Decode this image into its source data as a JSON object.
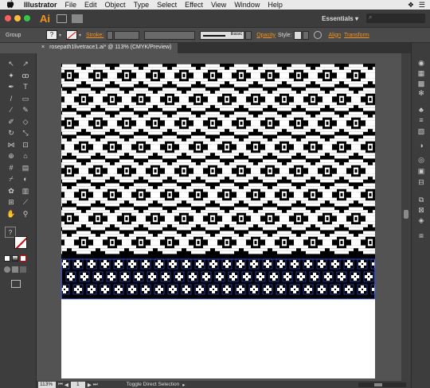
{
  "menubar": {
    "apple_icon": "apple-logo-icon",
    "app_name": "Illustrator",
    "items": [
      "File",
      "Edit",
      "Object",
      "Type",
      "Select",
      "Effect",
      "View",
      "Window",
      "Help"
    ],
    "status_glyph_1": "❖",
    "status_glyph_2": "☰"
  },
  "appbar": {
    "logo": "Ai",
    "workspace": "Essentials",
    "workspace_arrow": "▾",
    "search_glyph": "⌕"
  },
  "control": {
    "selection_type": "Group",
    "fill_q": "?",
    "stroke_label": "Stroke:",
    "brush_label": "Basic",
    "opacity_label": "Opacity",
    "style_label": "Style:",
    "align_label": "Align",
    "transform_label": "Transform"
  },
  "document": {
    "tab_title": "rosepath1livetrace1.ai* @ 113% (CMYK/Preview)",
    "close": "×"
  },
  "status": {
    "zoom": "113%",
    "page": "1",
    "text": "Toggle Direct Selection"
  },
  "toolbar": {
    "tools": [
      {
        "name": "selection-tool",
        "glyph": "↖"
      },
      {
        "name": "direct-selection-tool",
        "glyph": "↗"
      },
      {
        "name": "magic-wand-tool",
        "glyph": "✦"
      },
      {
        "name": "lasso-tool",
        "glyph": "ꝏ"
      },
      {
        "name": "pen-tool",
        "glyph": "✒"
      },
      {
        "name": "type-tool",
        "glyph": "T"
      },
      {
        "name": "line-tool",
        "glyph": "/"
      },
      {
        "name": "rectangle-tool",
        "glyph": "▭"
      },
      {
        "name": "paintbrush-tool",
        "glyph": "∕"
      },
      {
        "name": "pencil-tool",
        "glyph": "✎"
      },
      {
        "name": "blob-brush-tool",
        "glyph": "✐"
      },
      {
        "name": "eraser-tool",
        "glyph": "◇"
      },
      {
        "name": "rotate-tool",
        "glyph": "↻"
      },
      {
        "name": "scale-tool",
        "glyph": "⤡"
      },
      {
        "name": "width-tool",
        "glyph": "⋈"
      },
      {
        "name": "free-transform-tool",
        "glyph": "⊡"
      },
      {
        "name": "shape-builder-tool",
        "glyph": "⊕"
      },
      {
        "name": "perspective-grid-tool",
        "glyph": "⌂"
      },
      {
        "name": "mesh-tool",
        "glyph": "#"
      },
      {
        "name": "gradient-tool",
        "glyph": "▤"
      },
      {
        "name": "eyedropper-tool",
        "glyph": "⌿"
      },
      {
        "name": "blend-tool",
        "glyph": "◐"
      },
      {
        "name": "symbol-sprayer-tool",
        "glyph": "✿"
      },
      {
        "name": "column-graph-tool",
        "glyph": "▥"
      },
      {
        "name": "artboard-tool",
        "glyph": "⊞"
      },
      {
        "name": "slice-tool",
        "glyph": "⟋"
      },
      {
        "name": "hand-tool",
        "glyph": "✋"
      },
      {
        "name": "zoom-tool",
        "glyph": "⚲"
      }
    ]
  },
  "panels": {
    "icons": [
      {
        "name": "color-panel-icon",
        "glyph": "◉"
      },
      {
        "name": "color-guide-icon",
        "glyph": "▦"
      },
      {
        "name": "swatches-panel-icon",
        "glyph": "▩"
      },
      {
        "name": "brushes-panel-icon",
        "glyph": "✻"
      },
      {
        "name": "symbols-panel-icon",
        "glyph": "♣"
      },
      {
        "name": "stroke-panel-icon",
        "glyph": "≡"
      },
      {
        "name": "gradient-panel-icon",
        "glyph": "▧"
      },
      {
        "name": "transparency-panel-icon",
        "glyph": "◑"
      },
      {
        "name": "appearance-panel-icon",
        "glyph": "◎"
      },
      {
        "name": "graphic-styles-icon",
        "glyph": "▣"
      },
      {
        "name": "align-panel-icon",
        "glyph": "⊟"
      },
      {
        "name": "pathfinder-panel-icon",
        "glyph": "⧉"
      },
      {
        "name": "transform-panel-icon",
        "glyph": "⊠"
      },
      {
        "name": "layers-panel-icon",
        "glyph": "◈"
      },
      {
        "name": "artboards-panel-icon",
        "glyph": "⧈"
      }
    ]
  },
  "colors": {
    "accent": "#f7941d",
    "selection": "#3a5bff",
    "pattern": "#000000"
  }
}
